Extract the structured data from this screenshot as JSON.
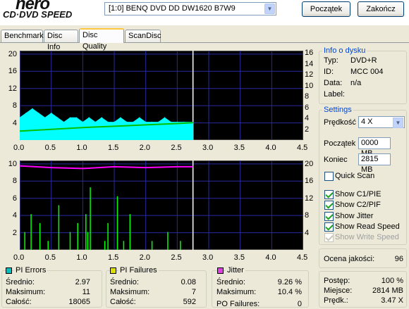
{
  "header": {
    "logo_top": "nero",
    "logo_bottom": "CD·DVD SPEED",
    "drive": "[1:0]  BENQ DVD DD DW1620 B7W9",
    "start_label": "Początek",
    "stop_label": "Zakończ"
  },
  "tabs": [
    "Benchmark",
    "Disc Info",
    "Disc Quality",
    "ScanDisc"
  ],
  "active_tab": "Disc Quality",
  "disc_info": {
    "legend": "Info o dysku",
    "type_label": "Typ:",
    "type_value": "DVD+R",
    "id_label": "ID:",
    "id_value": "MCC 004",
    "date_label": "Data:",
    "date_value": "n/a",
    "label_label": "Label:",
    "label_value": ""
  },
  "settings": {
    "legend": "Settings",
    "speed_label": "Prędkość",
    "speed_value": "4 X",
    "start_label": "Początek",
    "start_value": "0000 MB",
    "end_label": "Koniec",
    "end_value": "2815 MB",
    "quick_scan": "Quick Scan",
    "show_c1": "Show C1/PIE",
    "show_c2": "Show C2/PIF",
    "show_jitter": "Show Jitter",
    "show_read": "Show Read Speed",
    "show_write": "Show Write Speed"
  },
  "quality": {
    "label": "Ocena jakości:",
    "value": "96"
  },
  "progress": {
    "progress_label": "Postęp:",
    "progress_value": "100 %",
    "place_label": "Miejsce:",
    "place_value": "2814 MB",
    "speed_label": "Prędk.:",
    "speed_value": "3.47 X"
  },
  "pi_errors": {
    "title": "PI Errors",
    "color": "#00c0c0",
    "avg_label": "Średnio:",
    "avg": "2.97",
    "max_label": "Maksimum:",
    "max": "11",
    "total_label": "Całość:",
    "total": "18065"
  },
  "pi_failures": {
    "title": "PI Failures",
    "color": "#e0e000",
    "avg_label": "Średnio:",
    "avg": "0.08",
    "max_label": "Maksimum:",
    "max": "7",
    "total_label": "Całość:",
    "total": "592"
  },
  "jitter": {
    "title": "Jitter",
    "color": "#e040e0",
    "avg_label": "Średnio:",
    "avg": "9.26 %",
    "max_label": "Maksimum:",
    "max": "10.4 %",
    "po_label": "PO Failures:",
    "po": "0"
  },
  "chart_data": [
    {
      "type": "area",
      "x_ticks": [
        "0.0",
        "0.5",
        "1.0",
        "1.5",
        "2.0",
        "2.5",
        "3.0",
        "3.5",
        "4.0",
        "4.5"
      ],
      "y_left_ticks": [
        "20",
        "16",
        "12",
        "8",
        "4"
      ],
      "y_right_ticks": [
        "16",
        "14",
        "12",
        "10",
        "8",
        "6",
        "4",
        "2"
      ],
      "xlim": [
        0,
        4.5
      ],
      "ylim": [
        0,
        20
      ],
      "series": [
        {
          "name": "PI Errors",
          "color": "#00ffff",
          "x": [
            0.0,
            0.1,
            0.2,
            0.3,
            0.4,
            0.5,
            0.6,
            0.7,
            0.8,
            0.9,
            1.0,
            1.1,
            1.2,
            1.3,
            1.4,
            1.5,
            1.6,
            1.7,
            1.8,
            1.9,
            2.0,
            2.1,
            2.2,
            2.3,
            2.4,
            2.5,
            2.6,
            2.75
          ],
          "y": [
            5,
            6,
            7,
            6,
            5,
            6,
            5,
            4,
            5,
            5,
            4,
            5,
            4,
            5,
            4,
            4,
            5,
            4,
            4,
            5,
            4,
            4,
            4,
            5,
            4,
            4,
            4,
            4
          ]
        },
        {
          "name": "Read Speed",
          "color": "#00c000",
          "x": [
            0.0,
            0.5,
            1.0,
            1.5,
            2.0,
            2.5,
            2.75
          ],
          "y": [
            2.0,
            2.4,
            2.8,
            3.1,
            3.4,
            3.7,
            3.9
          ]
        }
      ]
    },
    {
      "type": "bar",
      "x_ticks": [
        "0.0",
        "0.5",
        "1.0",
        "1.5",
        "2.0",
        "2.5",
        "3.0",
        "3.5",
        "4.0",
        "4.5"
      ],
      "y_left_ticks": [
        "10",
        "8",
        "6",
        "4",
        "2"
      ],
      "y_right_ticks": [
        "20",
        "16",
        "12",
        "8",
        "4"
      ],
      "xlim": [
        0,
        4.5
      ],
      "ylim": [
        0,
        10
      ],
      "series": [
        {
          "name": "PI Failures",
          "color": "#00ff00",
          "x": [
            0.08,
            0.18,
            0.32,
            0.45,
            0.62,
            0.8,
            0.92,
            1.05,
            1.08,
            1.12,
            1.35,
            1.4,
            1.55,
            1.65,
            1.75,
            2.1,
            2.35,
            2.55
          ],
          "y": [
            2,
            4,
            3,
            1,
            5,
            2,
            3,
            4,
            2,
            7,
            1,
            3,
            6,
            1,
            4,
            1,
            2,
            1
          ]
        },
        {
          "name": "Jitter",
          "color": "#ff00ff",
          "x": [
            0.0,
            0.5,
            1.0,
            1.5,
            2.0,
            2.5,
            2.75
          ],
          "y": [
            9.4,
            9.2,
            9.1,
            9.3,
            9.2,
            9.3,
            9.3
          ]
        }
      ]
    }
  ]
}
